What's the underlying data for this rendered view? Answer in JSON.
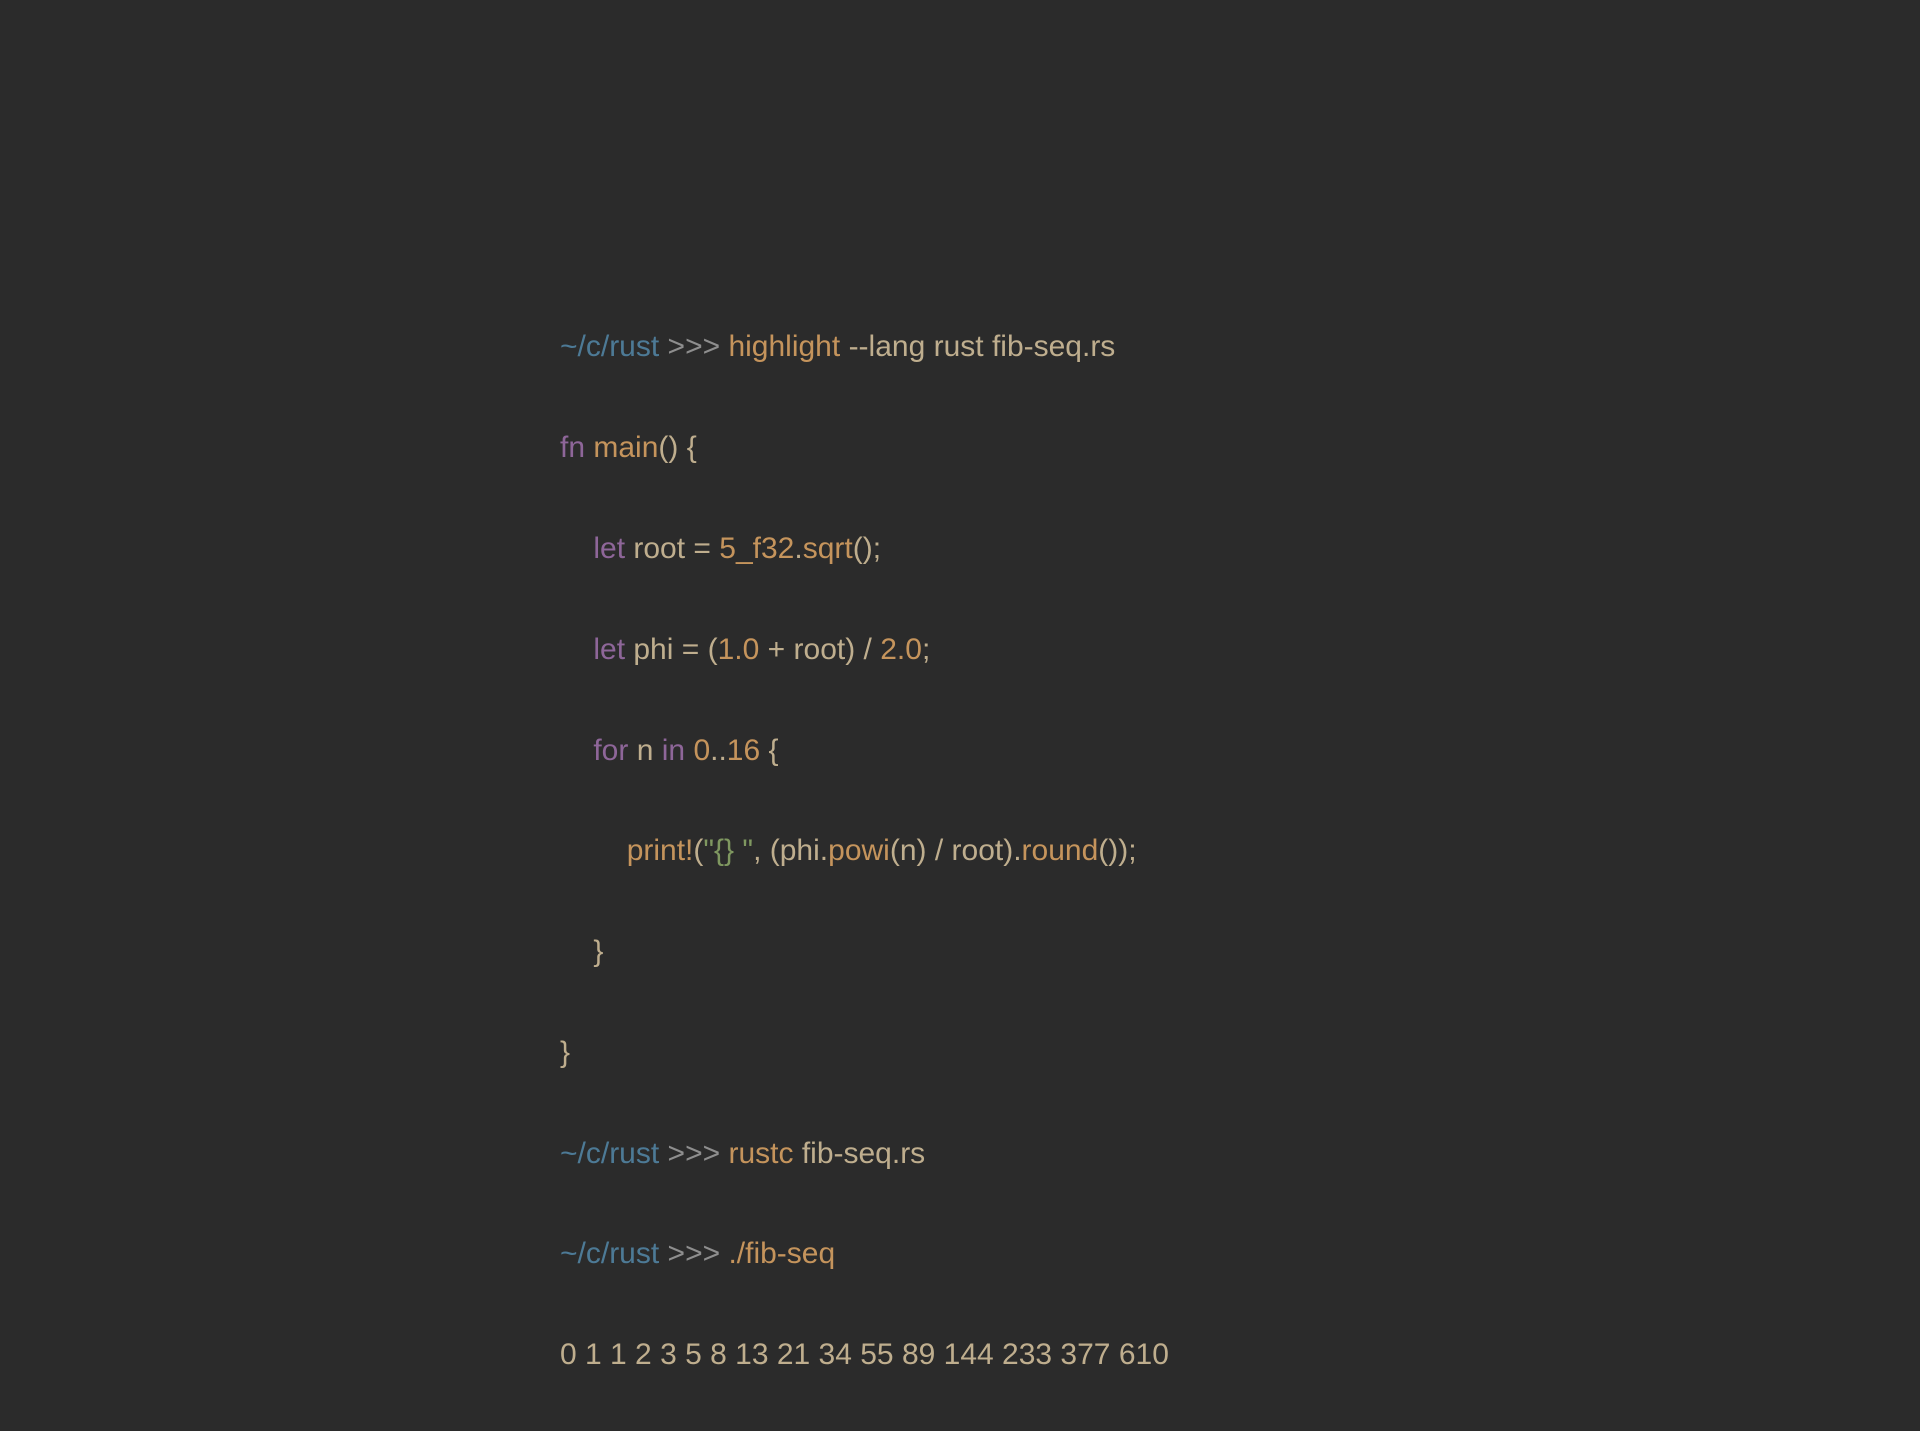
{
  "prompt": {
    "path": "~/c/rust",
    "chevrons": ">>>"
  },
  "cmd1": {
    "bin": "highlight",
    "args": "--lang rust fib-seq.rs"
  },
  "code": {
    "l0": {
      "fn": "fn",
      "main": "main",
      "open": "() {"
    },
    "l1": {
      "indent": "    ",
      "let": "let",
      "root": "root",
      "eq": " = ",
      "lit": "5_f32",
      "dot": ".",
      "sqrt": "sqrt",
      "tail": "();"
    },
    "l2": {
      "indent": "    ",
      "let": "let",
      "phi": "phi",
      "eq": " = (",
      "one": "1.0",
      "plus": " + ",
      "root": "root",
      "rp_div": ") / ",
      "two": "2.0",
      "semi": ";"
    },
    "l3": {
      "indent": "    ",
      "for": "for",
      "n": "n",
      "in": "in",
      "zero": "0",
      "dots": "..",
      "sixteen": "16",
      "brace": " {"
    },
    "l4": {
      "indent": "        ",
      "print": "print!",
      "lp": "(",
      "str": "\"{} \"",
      "comma": ", (",
      "phi": "phi",
      "dot1": ".",
      "powi": "powi",
      "args": "(n) / root)",
      "dot2": ".",
      "round": "round",
      "tail": "());"
    },
    "l5": {
      "indent": "    ",
      "brace": "}"
    },
    "l6": {
      "brace": "}"
    }
  },
  "cmd2": {
    "bin": "rustc",
    "args": "fib-seq.rs"
  },
  "cmd3": {
    "bin": "./fib-seq"
  },
  "output": "0 1 1 2 3 5 8 13 21 34 55 89 144 233 377 610"
}
